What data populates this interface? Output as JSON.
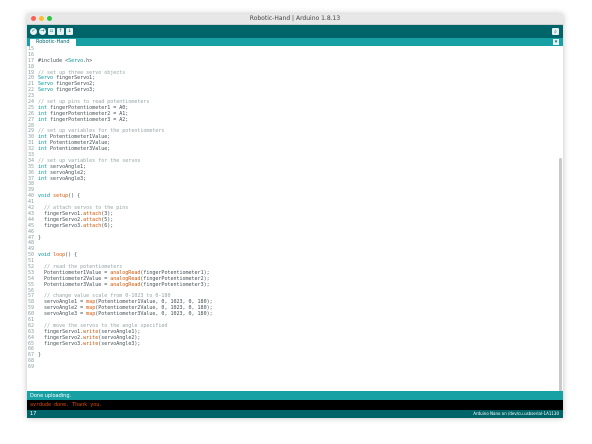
{
  "window": {
    "title": "Robotic-Hand | Arduino 1.8.13"
  },
  "colors": {
    "toolbar": "#006468",
    "tabbar": "#17a1a5",
    "console_text": "#e34c00"
  },
  "toolbar": {
    "buttons": [
      {
        "name": "verify-icon",
        "glyph": "✓"
      },
      {
        "name": "upload-icon",
        "glyph": "→"
      },
      {
        "name": "new-icon",
        "glyph": "▫"
      },
      {
        "name": "open-icon",
        "glyph": "↑"
      },
      {
        "name": "save-icon",
        "glyph": "↓"
      }
    ],
    "serial_glyph": "⌕"
  },
  "tab": {
    "label": "Robotic-Hand",
    "menu_glyph": "▾"
  },
  "code_lines": [
    {
      "n": "15",
      "t": ""
    },
    {
      "n": "16",
      "t": ""
    },
    {
      "n": "17",
      "t": "#include <Servo.h>"
    },
    {
      "n": "18",
      "t": ""
    },
    {
      "n": "19",
      "t": "// set up three servo objects"
    },
    {
      "n": "20",
      "t": "Servo fingerServo1;"
    },
    {
      "n": "21",
      "t": "Servo fingerServo2;"
    },
    {
      "n": "22",
      "t": "Servo fingerServo3;"
    },
    {
      "n": "23",
      "t": ""
    },
    {
      "n": "24",
      "t": "// set up pins to read potentiometers"
    },
    {
      "n": "25",
      "t": "int fingerPotentiometer1 = A0;"
    },
    {
      "n": "26",
      "t": "int fingerPotentiometer2 = A1;"
    },
    {
      "n": "27",
      "t": "int fingerPotentiometer3 = A2;"
    },
    {
      "n": "28",
      "t": ""
    },
    {
      "n": "29",
      "t": "// set up variables for the potentiometers"
    },
    {
      "n": "30",
      "t": "int Potentiometer1Value;"
    },
    {
      "n": "31",
      "t": "int Potentiometer2Value;"
    },
    {
      "n": "32",
      "t": "int Potentiometer3Value;"
    },
    {
      "n": "33",
      "t": ""
    },
    {
      "n": "34",
      "t": "// set up variables for the servos"
    },
    {
      "n": "35",
      "t": "int servoAngle1;"
    },
    {
      "n": "36",
      "t": "int servoAngle2;"
    },
    {
      "n": "37",
      "t": "int servoAngle3;"
    },
    {
      "n": "38",
      "t": ""
    },
    {
      "n": "39",
      "t": ""
    },
    {
      "n": "40",
      "t": "void setup() {"
    },
    {
      "n": "41",
      "t": ""
    },
    {
      "n": "42",
      "t": "  // attach servos to the pins"
    },
    {
      "n": "43",
      "t": "  fingerServo1.attach(3);"
    },
    {
      "n": "44",
      "t": "  fingerServo2.attach(5);"
    },
    {
      "n": "45",
      "t": "  fingerServo3.attach(6);"
    },
    {
      "n": "46",
      "t": ""
    },
    {
      "n": "47",
      "t": "}"
    },
    {
      "n": "48",
      "t": ""
    },
    {
      "n": "49",
      "t": ""
    },
    {
      "n": "50",
      "t": "void loop() {"
    },
    {
      "n": "51",
      "t": ""
    },
    {
      "n": "52",
      "t": "  // read the potentiometers"
    },
    {
      "n": "53",
      "t": "  Potentiometer1Value = analogRead(fingerPotentiometer1);"
    },
    {
      "n": "54",
      "t": "  Potentiometer2Value = analogRead(fingerPotentiometer2);"
    },
    {
      "n": "55",
      "t": "  Potentiometer3Value = analogRead(fingerPotentiometer3);"
    },
    {
      "n": "56",
      "t": ""
    },
    {
      "n": "57",
      "t": "  // change value scale from 0-1023 to 0-180"
    },
    {
      "n": "58",
      "t": "  servoAngle1 = map(Potentiometer1Value, 0, 1023, 0, 180);"
    },
    {
      "n": "59",
      "t": "  servoAngle2 = map(Potentiometer2Value, 0, 1023, 0, 180);"
    },
    {
      "n": "60",
      "t": "  servoAngle3 = map(Potentiometer3Value, 0, 1023, 0, 180);"
    },
    {
      "n": "61",
      "t": ""
    },
    {
      "n": "62",
      "t": "  // move the servos to the angle specified"
    },
    {
      "n": "63",
      "t": "  fingerServo1.write(servoAngle1);"
    },
    {
      "n": "64",
      "t": "  fingerServo2.write(servoAngle2);"
    },
    {
      "n": "65",
      "t": "  fingerServo3.write(servoAngle3);"
    },
    {
      "n": "66",
      "t": ""
    },
    {
      "n": "67",
      "t": "}"
    },
    {
      "n": "68",
      "t": ""
    },
    {
      "n": "69",
      "t": ""
    }
  ],
  "status": {
    "message": "Done uploading."
  },
  "console": {
    "text": "avrdude done.  Thank you."
  },
  "bottom": {
    "line": "17",
    "board": "Arduino Nano on /dev/cu.usbserial-1A1130"
  }
}
